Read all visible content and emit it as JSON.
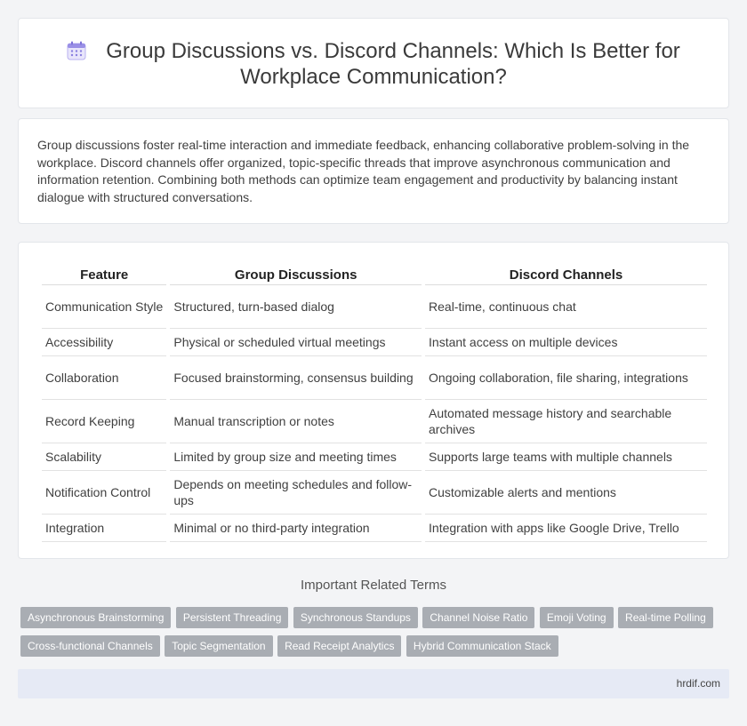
{
  "header": {
    "title": "Group Discussions vs. Discord Channels: Which Is Better for Workplace Communication?",
    "icon": "calendar-icon"
  },
  "intro": {
    "text": "Group discussions foster real-time interaction and immediate feedback, enhancing collaborative problem-solving in the workplace. Discord channels offer organized, topic-specific threads that improve asynchronous communication and information retention. Combining both methods can optimize team engagement and productivity by balancing instant dialogue with structured conversations."
  },
  "table": {
    "headers": [
      "Feature",
      "Group Discussions",
      "Discord Channels"
    ],
    "rows": [
      [
        "Communication Style",
        "Structured, turn-based dialog",
        "Real-time, continuous chat"
      ],
      [
        "Accessibility",
        "Physical or scheduled virtual meetings",
        "Instant access on multiple devices"
      ],
      [
        "Collaboration",
        "Focused brainstorming, consensus building",
        "Ongoing collaboration, file sharing, integrations"
      ],
      [
        "Record Keeping",
        "Manual transcription or notes",
        "Automated message history and searchable archives"
      ],
      [
        "Scalability",
        "Limited by group size and meeting times",
        "Supports large teams with multiple channels"
      ],
      [
        "Notification Control",
        "Depends on meeting schedules and follow-ups",
        "Customizable alerts and mentions"
      ],
      [
        "Integration",
        "Minimal or no third-party integration",
        "Integration with apps like Google Drive, Trello"
      ]
    ]
  },
  "related": {
    "title": "Important Related Terms",
    "tags": [
      "Asynchronous Brainstorming",
      "Persistent Threading",
      "Synchronous Standups",
      "Channel Noise Ratio",
      "Emoji Voting",
      "Real-time Polling",
      "Cross-functional Channels",
      "Topic Segmentation",
      "Read Receipt Analytics",
      "Hybrid Communication Stack"
    ]
  },
  "footer": {
    "site": "hrdif.com"
  },
  "colors": {
    "tag_bg": "#a9adb3",
    "footer_bg": "#e6eaf5",
    "icon_accent": "#8a7fe0"
  }
}
